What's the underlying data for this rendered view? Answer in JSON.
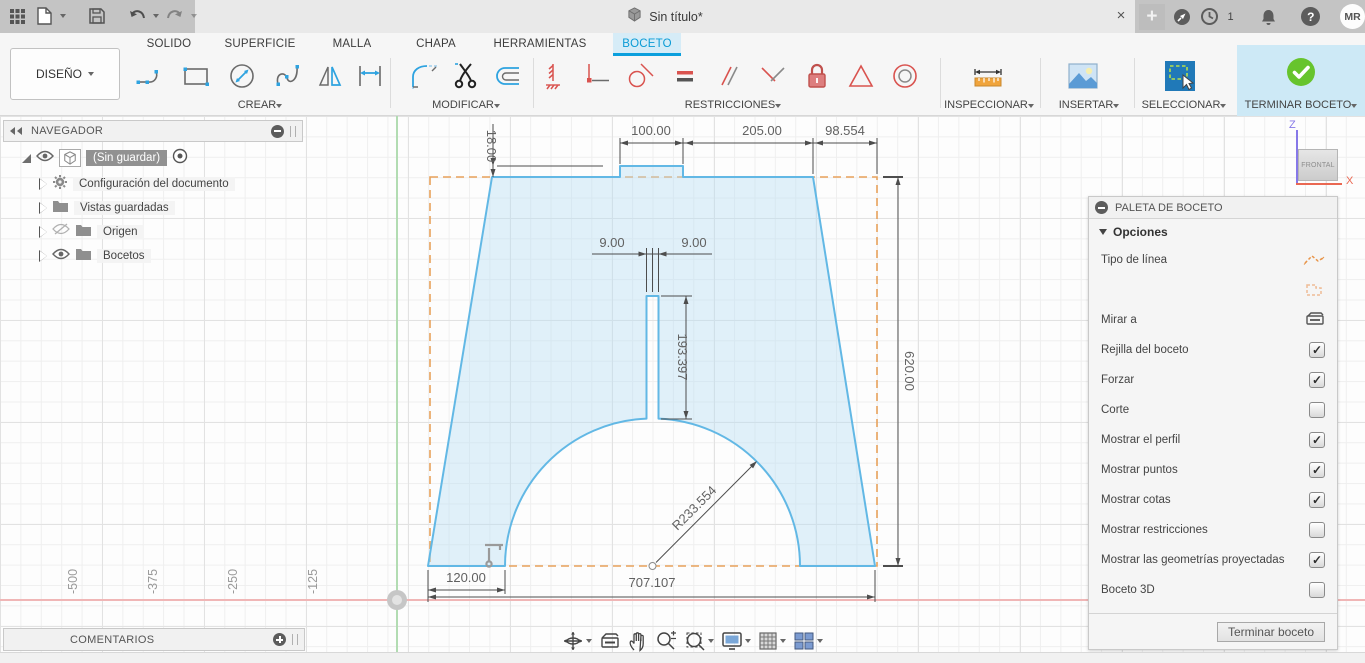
{
  "titlebar": {
    "title": "Sin título*",
    "close_icon": "×",
    "clock_badge": "1",
    "help_label": "?",
    "avatar": "MR"
  },
  "ribbon": {
    "design_button": "DISEÑO",
    "tabs": [
      {
        "label": "SOLIDO"
      },
      {
        "label": "SUPERFICIE"
      },
      {
        "label": "MALLA"
      },
      {
        "label": "CHAPA"
      },
      {
        "label": "HERRAMIENTAS"
      },
      {
        "label": "BOCETO",
        "active": true
      }
    ],
    "groups": {
      "crear": "CREAR",
      "modificar": "MODIFICAR",
      "restricciones": "RESTRICCIONES",
      "inspeccionar": "INSPECCIONAR",
      "insertar": "INSERTAR",
      "seleccionar": "SELECCIONAR",
      "terminar": "TERMINAR BOCETO"
    }
  },
  "navigator": {
    "title": "NAVEGADOR",
    "root_label": "(Sin guardar)",
    "items": [
      {
        "label": "Configuración del documento"
      },
      {
        "label": "Vistas guardadas"
      },
      {
        "label": "Origen"
      },
      {
        "label": "Bocetos"
      }
    ]
  },
  "palette": {
    "title": "PALETA DE BOCETO",
    "section": "Opciones",
    "rows": [
      {
        "label": "Tipo de línea"
      },
      {
        "label": ""
      },
      {
        "label": "Mirar a"
      },
      {
        "label": "Rejilla del boceto",
        "check": "✓"
      },
      {
        "label": "Forzar",
        "check": "✓"
      },
      {
        "label": "Corte",
        "check": ""
      },
      {
        "label": "Mostrar el perfil",
        "check": "✓"
      },
      {
        "label": "Mostrar puntos",
        "check": "✓"
      },
      {
        "label": "Mostrar cotas",
        "check": "✓"
      },
      {
        "label": "Mostrar restricciones",
        "check": ""
      },
      {
        "label": "Mostrar las geometrías proyectadas",
        "check": "✓"
      },
      {
        "label": "Boceto 3D",
        "check": ""
      }
    ],
    "finish_button": "Terminar boceto"
  },
  "comments": {
    "title": "COMENTARIOS"
  },
  "viewcube": {
    "face": "FRONTAL",
    "axis_z": "Z",
    "axis_x": "X"
  },
  "sketch": {
    "dimensions": {
      "tab_height": "18.00",
      "tab_width": "100.00",
      "top_right_span": "205.00",
      "right_slope_run": "98.554",
      "slot_left_offset": "9.00",
      "slot_right_offset": "9.00",
      "slot_depth": "193.397",
      "total_height": "620.00",
      "arc_radius": "R233.554",
      "foot_width": "120.00",
      "total_width": "707.107"
    },
    "axis_labels": [
      "-500",
      "-375",
      "-250",
      "-125"
    ]
  }
}
